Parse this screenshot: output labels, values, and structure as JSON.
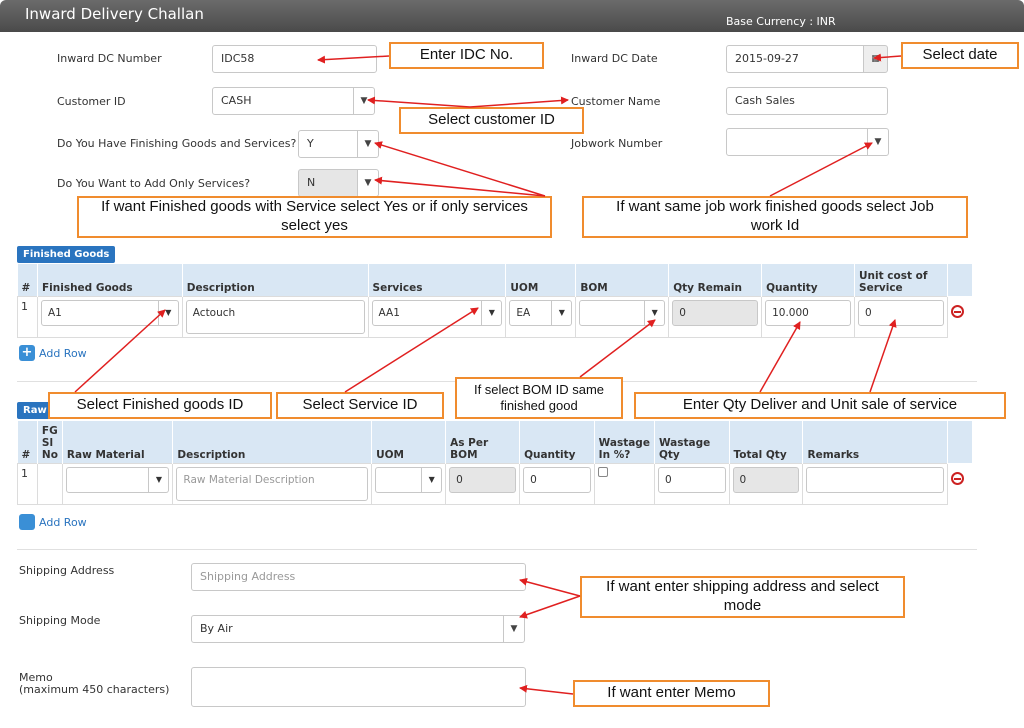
{
  "header": {
    "title": "Inward Delivery Challan",
    "currency": "Base Currency : INR"
  },
  "form": {
    "dc_number_label": "Inward DC Number",
    "dc_number_value": "IDC58",
    "dc_date_label": "Inward DC Date",
    "dc_date_value": "2015-09-27",
    "customer_id_label": "Customer ID",
    "customer_id_value": "CASH",
    "customer_name_label": "Customer Name",
    "customer_name_value": "Cash Sales",
    "finishing_label": "Do You Have Finishing Goods and Services?",
    "finishing_value": "Y",
    "jobwork_label": "Jobwork Number",
    "jobwork_value": "",
    "services_only_label": "Do You Want to Add Only Services?",
    "services_only_value": "N"
  },
  "finished_goods": {
    "badge": "Finished Goods",
    "headers": [
      "#",
      "Finished Goods",
      "Description",
      "Services",
      "UOM",
      "BOM",
      "Qty Remain",
      "Quantity",
      "Unit cost of Service"
    ],
    "row": {
      "num": "1",
      "goods": "A1",
      "description": "Actouch",
      "service": "AA1",
      "uom": "EA",
      "bom": "",
      "qty_remain": "0",
      "quantity": "10.000",
      "unit_cost": "0"
    },
    "add_row": "Add Row"
  },
  "raw_materials": {
    "badge": "Raw",
    "headers": [
      "#",
      "FG Sl No",
      "Raw Material",
      "Description",
      "UOM",
      "As Per BOM",
      "Quantity",
      "Wastage In %?",
      "Wastage Qty",
      "Total Qty",
      "Remarks"
    ],
    "row": {
      "num": "1",
      "description_placeholder": "Raw Material Description",
      "as_per_bom": "0",
      "quantity": "0",
      "wastage_qty": "0",
      "total_qty": "0"
    },
    "add_row": "Add Row"
  },
  "shipping": {
    "address_label": "Shipping Address",
    "address_placeholder": "Shipping Address",
    "mode_label": "Shipping Mode",
    "mode_value": "By Air",
    "memo_label": "Memo",
    "memo_sublabel": "(maximum 450 characters)"
  },
  "callouts": {
    "idc": "Enter IDC No.",
    "date": "Select date",
    "customer": "Select customer ID",
    "finished_services": "If want Finished goods with Service select Yes or if only services select yes",
    "jobwork": "If want same job work finished goods select Job work Id",
    "fg_id": "Select Finished goods ID",
    "service_id": "Select Service ID",
    "bom": "If select BOM ID same finished good",
    "qty": "Enter Qty Deliver and Unit sale of service",
    "shipping": "If want enter shipping address and select mode",
    "memo": "If want enter Memo"
  },
  "colors": {
    "header_bg": "#555555",
    "accent": "#2a74bf",
    "callout_border": "#f08c2e",
    "arrow": "#e02020"
  }
}
